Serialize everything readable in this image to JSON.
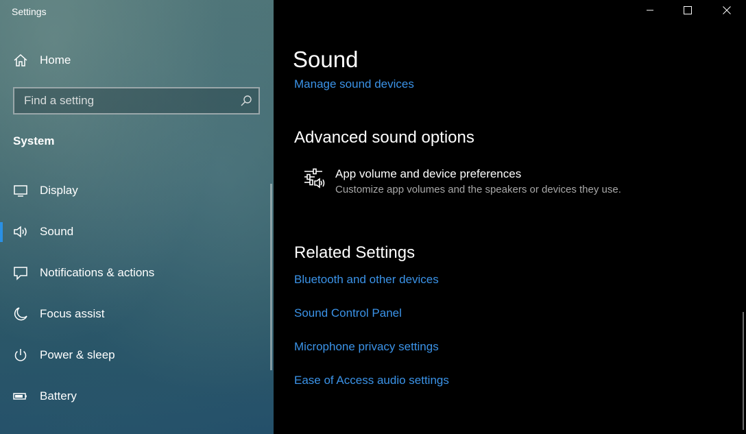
{
  "window": {
    "title": "Settings",
    "minimize_icon": "minimize-icon",
    "maximize_icon": "maximize-icon",
    "close_icon": "close-icon"
  },
  "sidebar": {
    "home": {
      "label": "Home",
      "icon": "home-icon"
    },
    "search": {
      "placeholder": "Find a setting",
      "value": "",
      "icon": "search-icon"
    },
    "section_title": "System",
    "items": [
      {
        "label": "Display",
        "icon": "display-icon",
        "selected": false
      },
      {
        "label": "Sound",
        "icon": "speaker-icon",
        "selected": true
      },
      {
        "label": "Notifications & actions",
        "icon": "notification-icon",
        "selected": false
      },
      {
        "label": "Focus assist",
        "icon": "moon-icon",
        "selected": false
      },
      {
        "label": "Power & sleep",
        "icon": "power-icon",
        "selected": false
      },
      {
        "label": "Battery",
        "icon": "battery-icon",
        "selected": false
      }
    ]
  },
  "main": {
    "title": "Sound",
    "manage_devices_link": "Manage sound devices",
    "advanced": {
      "heading": "Advanced sound options",
      "item": {
        "title": "App volume and device preferences",
        "description": "Customize app volumes and the speakers or devices they use.",
        "icon": "app-volume-mixer-icon"
      }
    },
    "related": {
      "heading": "Related Settings",
      "links": [
        "Bluetooth and other devices",
        "Sound Control Panel",
        "Microphone privacy settings",
        "Ease of Access audio settings"
      ]
    }
  },
  "colors": {
    "accent": "#2a90e4",
    "link": "#3b93e8",
    "main_background": "#000000",
    "secondary_text": "#a8a8a8"
  }
}
